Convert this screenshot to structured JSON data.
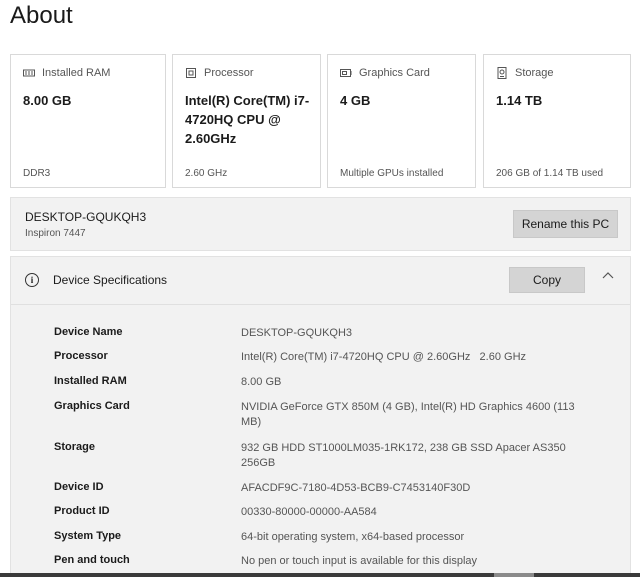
{
  "page": {
    "title": "About"
  },
  "cards": [
    {
      "label": "Installed RAM",
      "icon": "ram-icon",
      "value": "8.00 GB",
      "sub": "DDR3"
    },
    {
      "label": "Processor",
      "icon": "processor-icon",
      "value": "Intel(R) Core(TM) i7-4720HQ CPU @ 2.60GHz",
      "sub": "2.60 GHz"
    },
    {
      "label": "Graphics Card",
      "icon": "graphics-card-icon",
      "value": "4 GB",
      "sub": "Multiple GPUs installed"
    },
    {
      "label": "Storage",
      "icon": "storage-icon",
      "value": "1.14 TB",
      "sub": "206 GB of 1.14 TB used"
    }
  ],
  "pc": {
    "name": "DESKTOP-GQUKQH3",
    "model": "Inspiron 7447",
    "rename_label": "Rename this PC"
  },
  "specs": {
    "title": "Device Specifications",
    "copy_label": "Copy",
    "rows": [
      {
        "key": "Device Name",
        "value": "DESKTOP-GQUKQH3"
      },
      {
        "key": "Processor",
        "value": "Intel(R) Core(TM) i7-4720HQ CPU @ 2.60GHz   2.60 GHz"
      },
      {
        "key": "Installed RAM",
        "value": "8.00 GB"
      },
      {
        "key": "Graphics Card",
        "value": "NVIDIA GeForce GTX 850M (4 GB), Intel(R) HD Graphics 4600 (113 MB)"
      },
      {
        "key": "Storage",
        "value": "932 GB HDD ST1000LM035-1RK172, 238 GB SSD Apacer AS350 256GB"
      },
      {
        "key": "Device ID",
        "value": "AFACDF9C-7180-4D53-BCB9-C7453140F30D"
      },
      {
        "key": "Product ID",
        "value": "00330-80000-00000-AA584"
      },
      {
        "key": "System Type",
        "value": "64-bit operating system, x64-based processor"
      },
      {
        "key": "Pen and touch",
        "value": "No pen or touch input is available for this display"
      }
    ]
  }
}
